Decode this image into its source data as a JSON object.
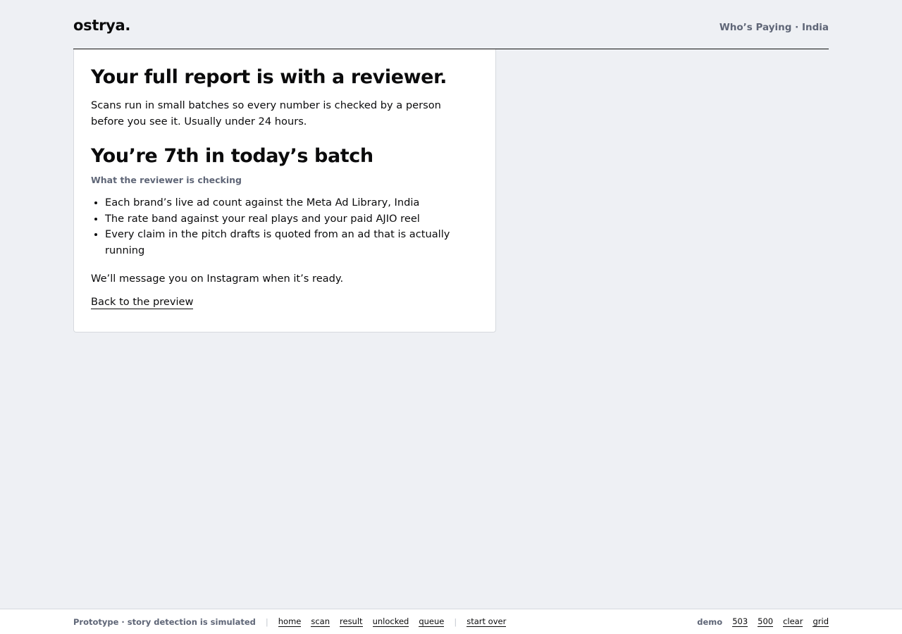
{
  "header": {
    "logo": "ostrya.",
    "tagline": "Who’s Paying · India"
  },
  "card": {
    "title": "Your full report is with a reviewer.",
    "lede": "Scans run in small batches so every number is checked by a person before you see it. Usually under 24 hours.",
    "batch_heading": "You’re 7th in today’s batch",
    "checking_label": "What the reviewer is checking",
    "checks": [
      "Each brand’s live ad count against the Meta Ad Library, India",
      "The rate band against your real plays and your paid AJIO reel",
      "Every claim in the pitch drafts is quoted from an ad that is actually running"
    ],
    "note": "We’ll message you on Instagram when it’s ready.",
    "back_link": "Back to the preview"
  },
  "footer": {
    "prototype_note": "Prototype · story detection is simulated",
    "nav": [
      "home",
      "scan",
      "result",
      "unlocked",
      "queue"
    ],
    "start_over": "start over",
    "demo_label": "demo",
    "demo_links": [
      "503",
      "500",
      "clear",
      "grid"
    ]
  }
}
